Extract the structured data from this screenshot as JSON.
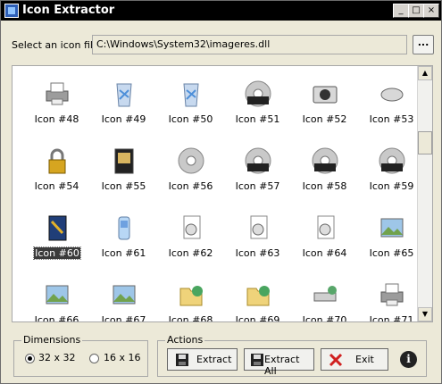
{
  "window": {
    "title": "Icon Extractor",
    "min_glyph": "_",
    "max_glyph": "□",
    "close_glyph": "×"
  },
  "file": {
    "label": "Select an icon file:",
    "value": "C:\\Windows\\System32\\imageres.dll",
    "browse_label": "..."
  },
  "icons": [
    {
      "label": "Icon #48",
      "icon": "printer-icon"
    },
    {
      "label": "Icon #49",
      "icon": "recycle-bin-full-icon"
    },
    {
      "label": "Icon #50",
      "icon": "recycle-bin-empty-icon"
    },
    {
      "label": "Icon #51",
      "icon": "dvd-icon"
    },
    {
      "label": "Icon #52",
      "icon": "camera-icon"
    },
    {
      "label": "Icon #53",
      "icon": "mouse-icon"
    },
    {
      "label": "Icon #54",
      "icon": "lock-icon"
    },
    {
      "label": "Icon #55",
      "icon": "media-player-icon"
    },
    {
      "label": "Icon #56",
      "icon": "cd-icon"
    },
    {
      "label": "Icon #57",
      "icon": "cd-r-icon"
    },
    {
      "label": "Icon #58",
      "icon": "cd-rom-icon"
    },
    {
      "label": "Icon #59",
      "icon": "cd-rw-icon"
    },
    {
      "label": "Icon #60",
      "icon": "book-icon",
      "selected": true
    },
    {
      "label": "Icon #61",
      "icon": "mobile-device-icon"
    },
    {
      "label": "Icon #62",
      "icon": "document-settings-icon"
    },
    {
      "label": "Icon #63",
      "icon": "settings-window-icon"
    },
    {
      "label": "Icon #64",
      "icon": "gear-document-icon"
    },
    {
      "label": "Icon #65",
      "icon": "photo-icon"
    },
    {
      "label": "Icon #66",
      "icon": "landscape-picture-icon"
    },
    {
      "label": "Icon #67",
      "icon": "wallpaper-icon"
    },
    {
      "label": "Icon #68",
      "icon": "network-folder-icon"
    },
    {
      "label": "Icon #69",
      "icon": "network-folder-open-icon"
    },
    {
      "label": "Icon #70",
      "icon": "network-drive-icon"
    },
    {
      "label": "Icon #71",
      "icon": "printer-icon"
    }
  ],
  "dimensions": {
    "legend": "Dimensions",
    "option_32": "32 x 32",
    "option_16": "16 x 16",
    "selected": "32 x 32"
  },
  "actions": {
    "legend": "Actions",
    "extract_label": "Extract",
    "extract_all_label": "Extract All",
    "exit_label": "Exit",
    "info_label": "i"
  },
  "colors": {
    "window_bg": "#ece9d8",
    "titlebar_bg": "#000000",
    "selection_bg": "#3b3b3b",
    "exit_icon": "#d02020"
  }
}
